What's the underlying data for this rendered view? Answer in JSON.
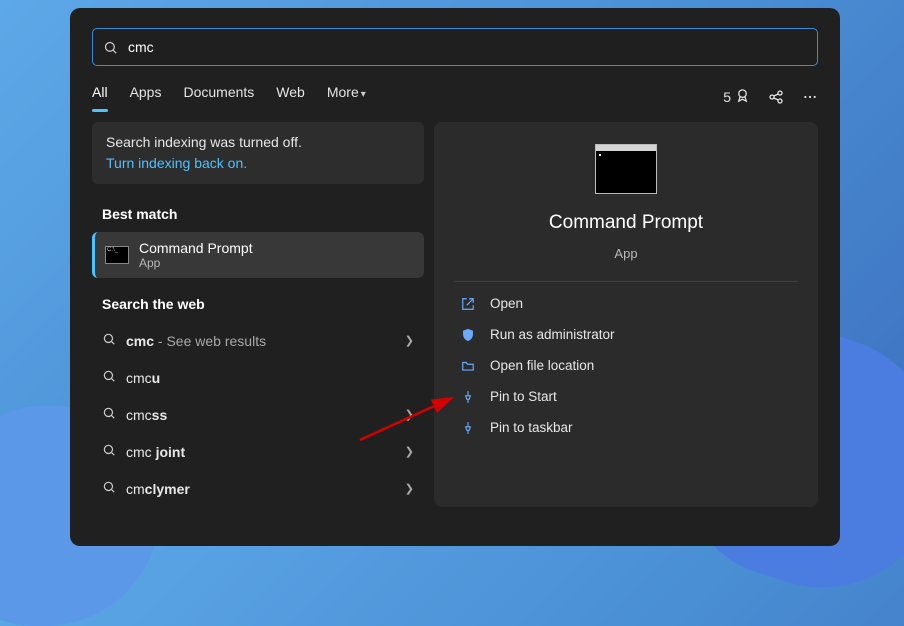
{
  "search": {
    "value": "cmc"
  },
  "tabs": {
    "all": "All",
    "apps": "Apps",
    "documents": "Documents",
    "web": "Web",
    "more": "More"
  },
  "topright": {
    "badge_count": "5"
  },
  "notice": {
    "line1": "Search indexing was turned off.",
    "link": "Turn indexing back on."
  },
  "sections": {
    "best_match": "Best match",
    "search_web": "Search the web"
  },
  "best": {
    "title": "Command Prompt",
    "subtitle": "App"
  },
  "web_items": [
    {
      "prefix": "cmc",
      "bold": "",
      "suffix": " - See web results"
    },
    {
      "prefix": "cmc",
      "bold": "u",
      "suffix": ""
    },
    {
      "prefix": "cmc",
      "bold": "ss",
      "suffix": ""
    },
    {
      "prefix": "cmc ",
      "bold": "joint",
      "suffix": ""
    },
    {
      "prefix": "cm",
      "bold": "clymer",
      "suffix": ""
    }
  ],
  "preview": {
    "title": "Command Prompt",
    "subtitle": "App"
  },
  "actions": {
    "open": "Open",
    "run_admin": "Run as administrator",
    "open_loc": "Open file location",
    "pin_start": "Pin to Start",
    "pin_taskbar": "Pin to taskbar"
  }
}
